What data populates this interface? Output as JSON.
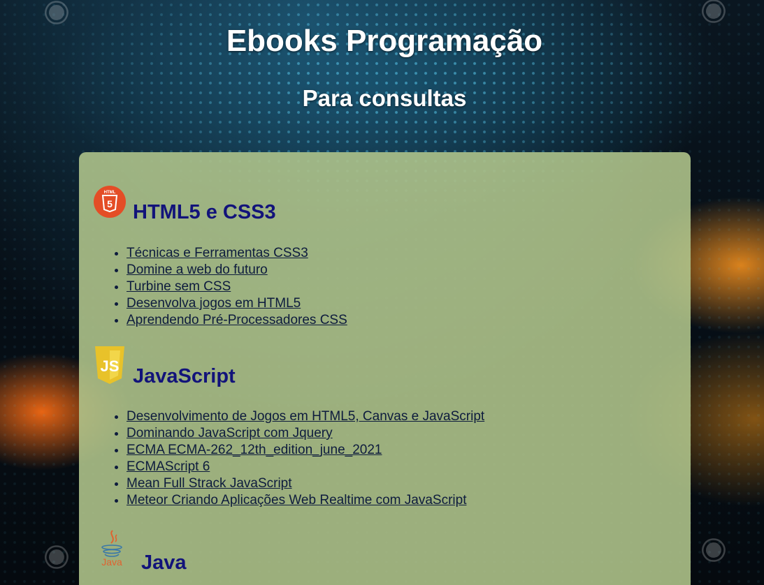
{
  "header": {
    "title": "Ebooks Programação",
    "subtitle": "Para consultas"
  },
  "sections": [
    {
      "title": "HTML5 e CSS3",
      "icon": "html5-icon",
      "links": [
        "Técnicas e Ferramentas CSS3",
        "Domine a web do futuro",
        "Turbine sem CSS",
        "Desenvolva jogos em HTML5",
        "Aprendendo Pré-Processadores CSS"
      ]
    },
    {
      "title": "JavaScript",
      "icon": "javascript-icon",
      "links": [
        "Desenvolvimento de Jogos em HTML5, Canvas e JavaScript",
        "Dominando JavaScript com Jquery",
        "ECMA ECMA-262_12th_edition_june_2021",
        "ECMAScript 6",
        "Mean Full Strack JavaScript",
        "Meteor Criando Aplicações Web Realtime com JavaScript"
      ]
    },
    {
      "title": "Java",
      "icon": "java-icon",
      "icon_text": "Java",
      "links": []
    }
  ],
  "icon_labels": {
    "html5_badge": "HTML",
    "html5_digit": "5"
  },
  "colors": {
    "panel": "#b2c68c",
    "section_title": "#12137a",
    "link": "#0d1b3d",
    "html5": "#e44d26",
    "javascript": "#e8c22a",
    "java_text": "#e0622f"
  }
}
